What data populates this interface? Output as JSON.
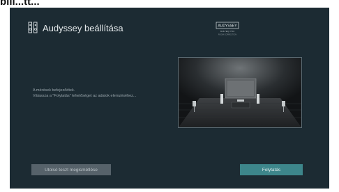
{
  "header": {
    "partial_label": "bill...tt...",
    "title": "Audyssey beállítása"
  },
  "logo": {
    "brand": "AUDYSSEY",
    "line1": "MULTEQ XT32",
    "line2": "ROOM CORRECTION"
  },
  "message": {
    "line1": "A mérések befejeződtek.",
    "line2": "Válassza a \"Folytatás\" lehetőséget az adatok elemzéséhez..."
  },
  "buttons": {
    "retry_label": "Utolsó teszt megismétlése",
    "continue_label": "Folytatás"
  },
  "colors": {
    "background": "#1c2b33",
    "retry_button": "#56626a",
    "continue_button": "#3d868b"
  },
  "icons": {
    "title": "speaker-pair-icon"
  }
}
